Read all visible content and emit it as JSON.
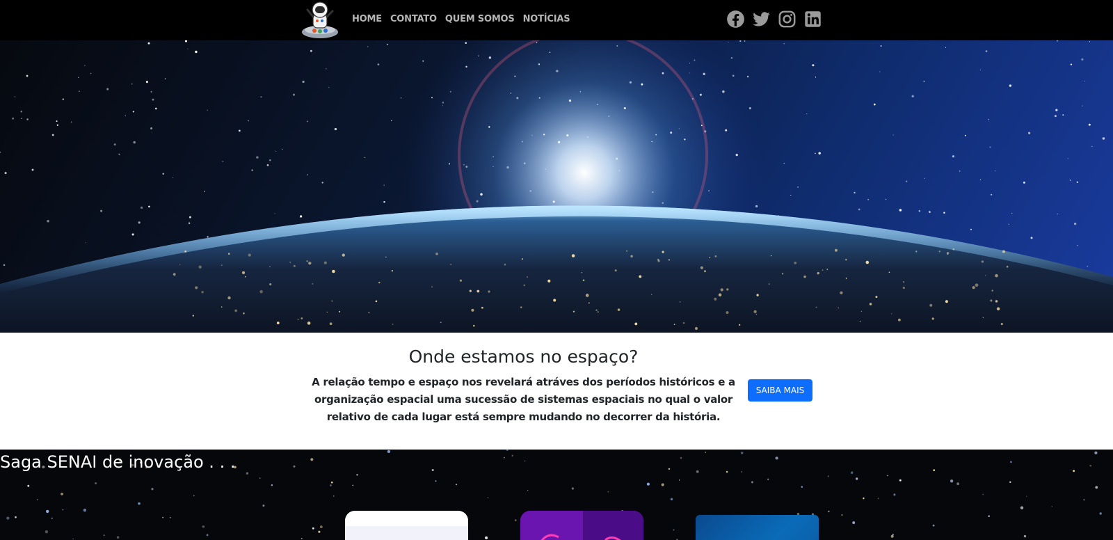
{
  "nav": {
    "links": [
      "HOME",
      "CONTATO",
      "QUEM SOMOS",
      "NOTÍCIAS"
    ],
    "social": [
      "facebook-icon",
      "twitter-icon",
      "instagram-icon",
      "linkedin-icon"
    ]
  },
  "intro": {
    "title": "Onde estamos no espaço?",
    "text": "A relação tempo e espaço nos revelará atráves dos períodos históricos e a organização espacial uma sucessão de sistemas espaciais no qual o valor relativo de cada lugar está sempre mudando no decorrer da história.",
    "button": "SAIBA MAIS"
  },
  "saga": {
    "title": "Saga SENAI de inovação . . ."
  },
  "colors": {
    "navbar": "#000000",
    "nav_link": "#b5b5b5",
    "button": "#0d6efd",
    "social_icon": "#9a9a9a"
  }
}
